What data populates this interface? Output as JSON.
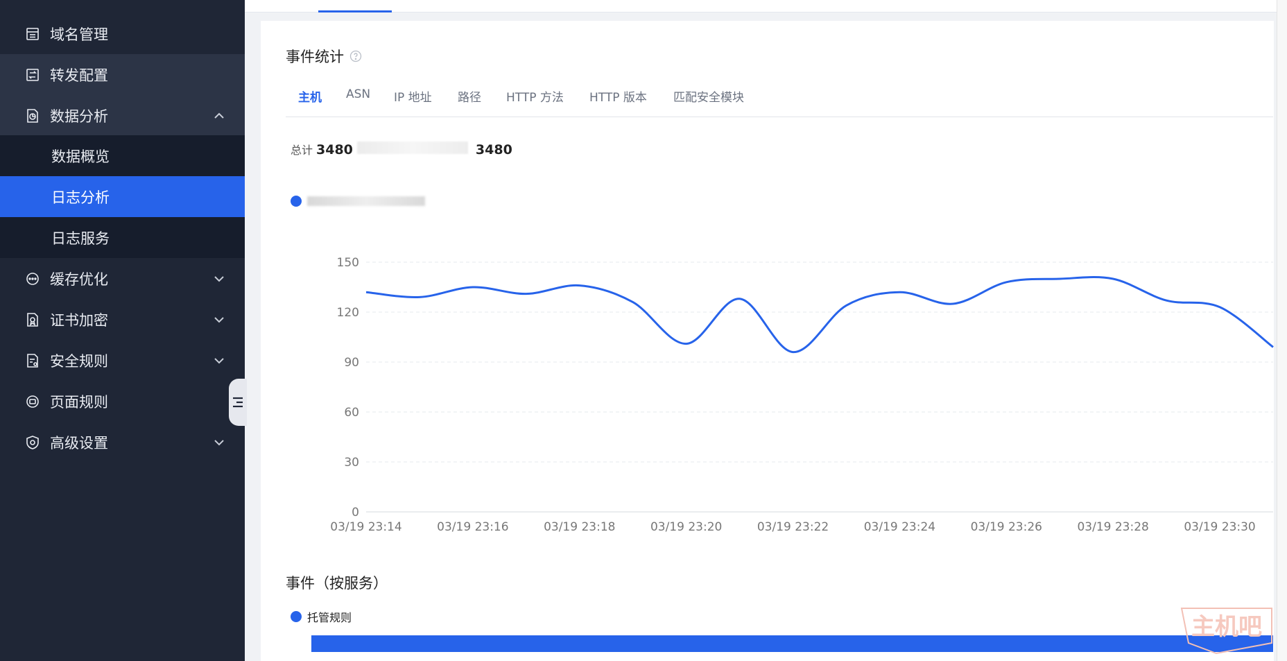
{
  "sidebar": {
    "items": [
      {
        "label": "域名管理",
        "icon": "domain-icon"
      },
      {
        "label": "转发配置",
        "icon": "forward-config-icon"
      },
      {
        "label": "数据分析",
        "icon": "analytics-icon"
      },
      {
        "label": "缓存优化",
        "icon": "cache-icon"
      },
      {
        "label": "证书加密",
        "icon": "certificate-icon"
      },
      {
        "label": "安全规则",
        "icon": "security-rule-icon"
      },
      {
        "label": "页面规则",
        "icon": "page-rule-icon"
      },
      {
        "label": "高级设置",
        "icon": "advanced-settings-icon"
      }
    ],
    "sub_items": [
      {
        "label": "数据概览"
      },
      {
        "label": "日志分析",
        "active": true
      },
      {
        "label": "日志服务"
      }
    ]
  },
  "main": {
    "title": "事件统计",
    "tabs": [
      "主机",
      "ASN",
      "IP 地址",
      "路径",
      "HTTP 方法",
      "HTTP 版本",
      "匹配安全模块"
    ],
    "active_tab": "主机",
    "total_label": "总计",
    "total_value": "3480",
    "total_value_2": "3480",
    "accent_color": "#2763ea"
  },
  "chart_data": {
    "type": "line",
    "x": [
      "03/19 23:14",
      "03/19 23:15",
      "03/19 23:16",
      "03/19 23:17",
      "03/19 23:18",
      "03/19 23:19",
      "03/19 23:20",
      "03/19 23:21",
      "03/19 23:22",
      "03/19 23:23",
      "03/19 23:24",
      "03/19 23:25",
      "03/19 23:26",
      "03/19 23:27",
      "03/19 23:28",
      "03/19 23:29",
      "03/19 23:30",
      "03/19 23:31"
    ],
    "x_ticks": [
      "03/19 23:14",
      "03/19 23:16",
      "03/19 23:18",
      "03/19 23:20",
      "03/19 23:22",
      "03/19 23:24",
      "03/19 23:26",
      "03/19 23:28",
      "03/19 23:30"
    ],
    "values": [
      132,
      129,
      135,
      131,
      136,
      126,
      101,
      128,
      96,
      124,
      132,
      125,
      138,
      140,
      140,
      127,
      123,
      99
    ],
    "ylim": [
      0,
      150
    ],
    "y_ticks": [
      0,
      30,
      60,
      90,
      120,
      150
    ],
    "grid": true
  },
  "section2": {
    "title": "事件（按服务）",
    "legend": "托管规则"
  },
  "watermark_text": "主机吧"
}
